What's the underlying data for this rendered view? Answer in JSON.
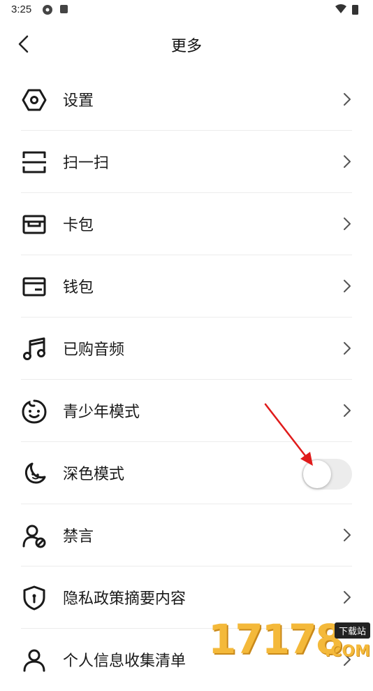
{
  "status_bar": {
    "time": "3:25"
  },
  "header": {
    "title": "更多"
  },
  "menu": {
    "items": [
      {
        "label": "设置",
        "icon": "hexagon-settings-icon"
      },
      {
        "label": "扫一扫",
        "icon": "scan-icon"
      },
      {
        "label": "卡包",
        "icon": "card-wallet-icon"
      },
      {
        "label": "钱包",
        "icon": "wallet-icon"
      },
      {
        "label": "已购音频",
        "icon": "music-note-icon"
      },
      {
        "label": "青少年模式",
        "icon": "smiley-face-icon"
      },
      {
        "label": "深色模式",
        "icon": "moon-icon",
        "toggle_on": false
      },
      {
        "label": "禁言",
        "icon": "user-mute-icon"
      },
      {
        "label": "隐私政策摘要内容",
        "icon": "shield-icon"
      },
      {
        "label": "个人信息收集清单",
        "icon": "user-icon"
      }
    ]
  },
  "watermark": {
    "digits": "17178",
    "tag": "下载站",
    "suffix": ".COM"
  },
  "colors": {
    "toggle_track": "#ececec",
    "accent_arrow": "#e01b1b"
  }
}
